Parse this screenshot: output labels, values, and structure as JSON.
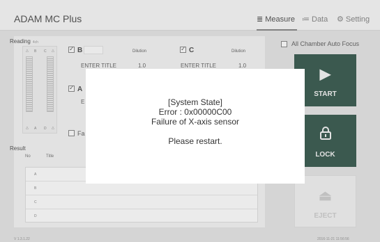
{
  "app": {
    "title": "ADAM MC Plus"
  },
  "nav": {
    "measure": "Measure",
    "data": "Data",
    "setting": "Setting"
  },
  "reading": {
    "label": "Reading",
    "sublabel": "4ch",
    "plate_top_labels": [
      "B",
      "C"
    ],
    "plate_bottom_labels": [
      "A",
      "D"
    ],
    "channels": [
      {
        "name": "B",
        "enter_title": "ENTER TITLE",
        "dilution_label": "Dilution",
        "dilution": "1.0"
      },
      {
        "name": "C",
        "enter_title": "ENTER TITLE",
        "dilution_label": "Dilution",
        "dilution": "1.0"
      },
      {
        "name": "A",
        "enter_title": "E"
      }
    ],
    "fast_label": "Fa"
  },
  "result": {
    "label": "Result",
    "columns": [
      "No",
      "Title"
    ],
    "rows": [
      "A",
      "B",
      "C",
      "D"
    ]
  },
  "controls": {
    "all_chamber_autofocus": "All Chamber Auto Focus",
    "start": "START",
    "lock": "LOCK",
    "eject": "EJECT"
  },
  "footer": {
    "version": "V 1.3.1.22",
    "timestamp": "2016-11-21 11:56:56"
  },
  "dialog": {
    "line1": "[System State]",
    "line2": "Error : 0x00000C00",
    "line3": "Failure of X-axis sensor",
    "line4": "Please restart."
  }
}
